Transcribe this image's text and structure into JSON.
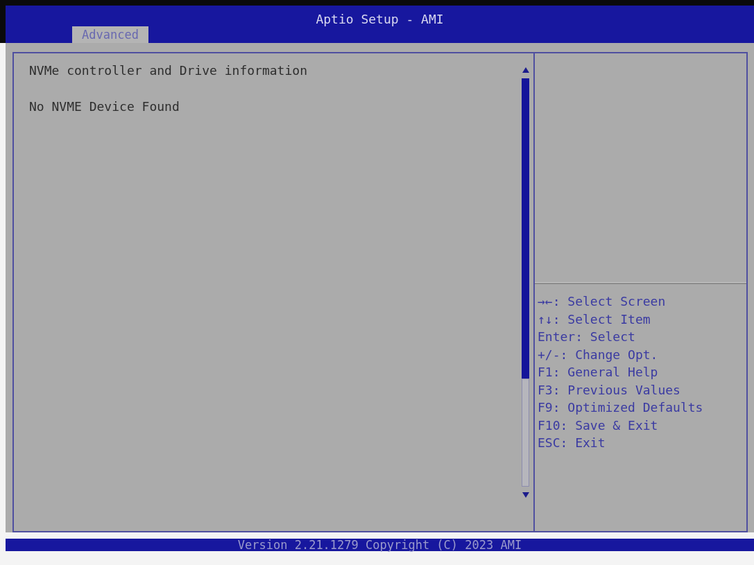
{
  "window": {
    "title": "Aptio Setup - AMI"
  },
  "tabs": [
    {
      "label": "Advanced",
      "selected": true
    }
  ],
  "main_panel": {
    "lines": [
      "NVMe controller and Drive information",
      "No NVME Device Found"
    ]
  },
  "help_panel": {
    "keys": [
      "→←: Select Screen",
      "↑↓: Select Item",
      "Enter: Select",
      "+/-: Change Opt.",
      "F1: General Help",
      "F3: Previous Values",
      "F9: Optimized Defaults",
      "F10: Save & Exit",
      "ESC: Exit"
    ]
  },
  "status_bar": {
    "text": "Version 2.21.1279 Copyright (C) 2023 AMI"
  }
}
